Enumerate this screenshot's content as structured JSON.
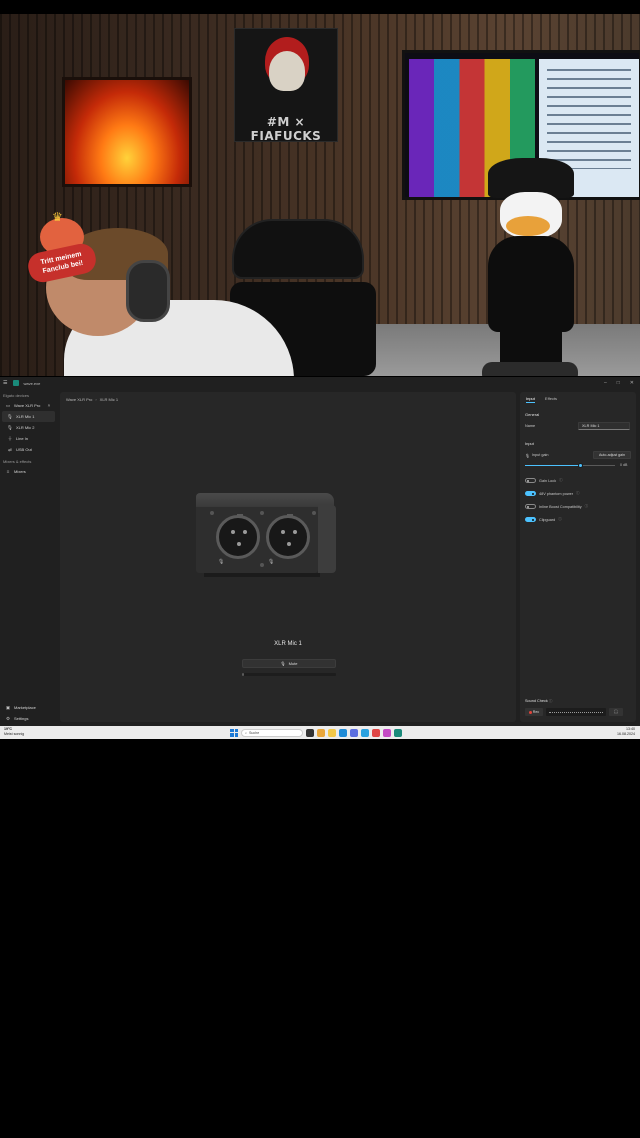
{
  "stream": {
    "badge_text": "Tritt meinem Fanclub bei!",
    "poster_text": "#M × FIAFUCKS"
  },
  "app": {
    "title": "wave.exe",
    "sidebar": {
      "section_devices": "Elgato devices",
      "device_name": "Wave XLR Pro",
      "items": [
        {
          "label": "XLR Mic 1",
          "icon": "microphone-icon"
        },
        {
          "label": "XLR Mic 2",
          "icon": "microphone-icon"
        },
        {
          "label": "Line In",
          "icon": "line-in-icon"
        },
        {
          "label": "USB Out",
          "icon": "usb-icon"
        }
      ],
      "section_mixers": "Mixers & effects",
      "mixers_label": "Mixers",
      "marketplace_label": "Marketplace",
      "settings_label": "Settings"
    },
    "main": {
      "breadcrumb_device": "Wave XLR Pro",
      "breadcrumb_channel": "XLR Mic 1",
      "channel_title": "XLR Mic 1",
      "mute_label": "Mute",
      "level_fraction": 0.02
    },
    "panel": {
      "tab_input": "Input",
      "tab_effects": "Effects",
      "section_general": "General",
      "name_label": "Name",
      "name_value": "XLR Mic 1",
      "section_input": "Input",
      "gain_label": "Input gain",
      "auto_gain_label": "Auto-adjust gain",
      "gain_value": "0 dB",
      "gain_fraction": 0.62,
      "toggles": [
        {
          "label": "Gain Lock",
          "on": false
        },
        {
          "label": "48V phantom power",
          "on": true
        },
        {
          "label": "Inline Boost Compatibility",
          "on": false
        },
        {
          "label": "Clipguard",
          "on": true
        }
      ],
      "sound_check_label": "Sound Check",
      "rec_label": "Rec"
    }
  },
  "taskbar": {
    "temp": "19°C",
    "weather_desc": "Meist sonnig",
    "search_label": "Suche",
    "time": "13:40",
    "date": "16.08.2024"
  },
  "colors": {
    "accent": "#4cc2ff",
    "app_bg": "#202020",
    "panel_bg": "#272727",
    "taskbar_bg": "#ececec"
  }
}
